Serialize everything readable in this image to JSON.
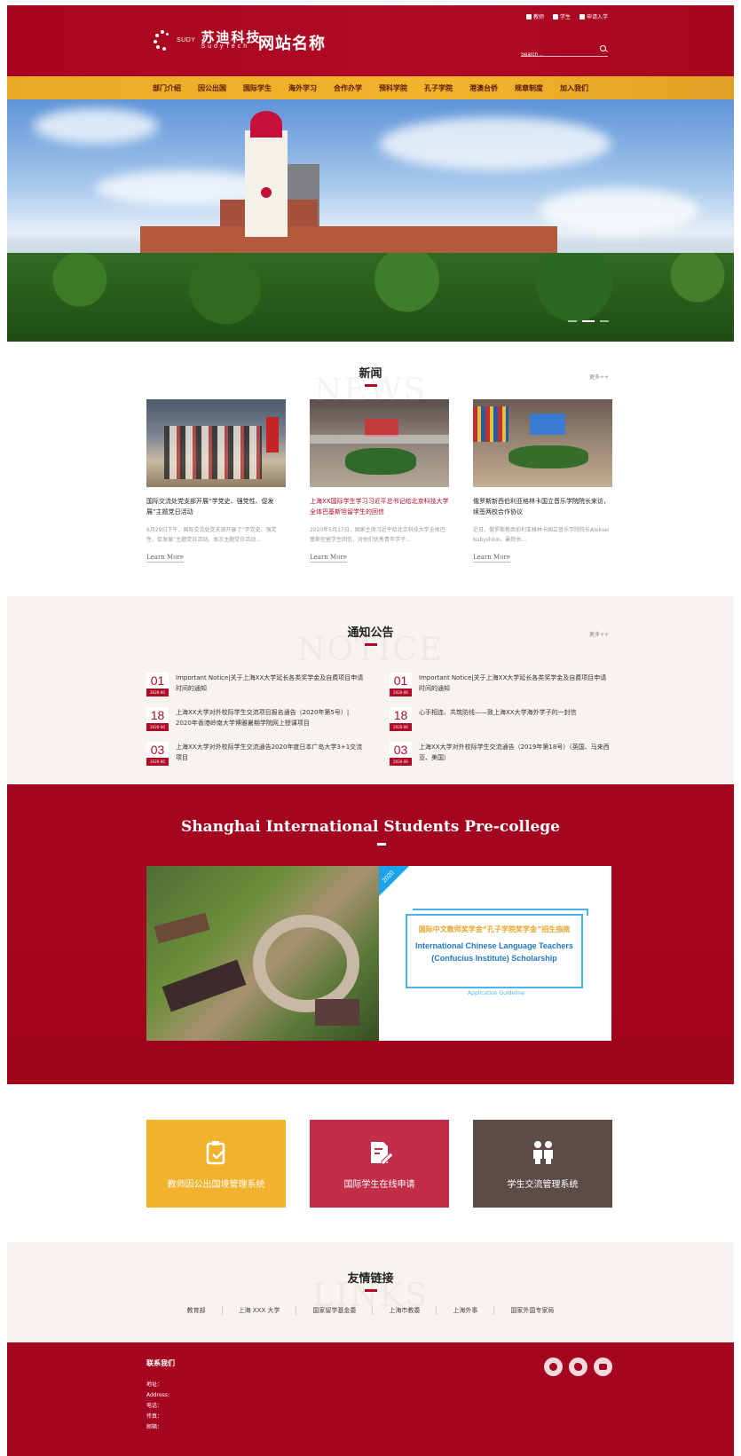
{
  "header": {
    "logo_sudy": "SUDY",
    "logo_cn": "苏迪科技",
    "logo_en": "SudyTech",
    "site_name": "网站名称",
    "top_links": [
      {
        "label": "教师"
      },
      {
        "label": "学生"
      },
      {
        "label": "申请入学"
      }
    ],
    "search_placeholder": "Search ...",
    "colors": {
      "primary": "#a8061f",
      "nav": "#f3b42c"
    }
  },
  "nav": {
    "items": [
      "部门介绍",
      "因公出国",
      "国际学生",
      "海外学习",
      "合作办学",
      "预科学院",
      "孔子学院",
      "港澳台侨",
      "规章制度",
      "加入我们"
    ]
  },
  "news": {
    "title_cn": "新闻",
    "title_en": "NEWS",
    "more": "更多++",
    "cards": [
      {
        "title": "国际交流处党支部开展“学党史、强党性、促发展”主题党日活动",
        "summary": "6月29日下午，国际交流处党支部开展了“学党史、强党性、促发展”主题党日活动。本次主题党日活动...",
        "learn": "Learn More",
        "highlight": false
      },
      {
        "title": "上海XX国际学生学习习近平总书记给北京科技大学全体巴基斯坦留学生的回信",
        "summary": "2020年5月17日，国家主席习近平给北京科技大学全体巴基斯坦留学生回信，对他们优秀青年学子...",
        "learn": "Learn More",
        "highlight": true
      },
      {
        "title": "俄罗斯新西伯利亚格林卡国立音乐学院院长来访，续签两校合作协议",
        "summary": "近日，俄罗斯新西伯利亚格林卡国立音乐学院院长Aleksei Kubyshkin、副院长...",
        "learn": "Learn More",
        "highlight": false
      }
    ]
  },
  "notice": {
    "title_cn": "通知公告",
    "title_en": "NOTICE",
    "more": "更多++",
    "items": [
      {
        "day": "01",
        "ym": "2020-06",
        "text": "Important Notice|关于上海XX大学延长各类奖学金及自费项目申请时间的通知"
      },
      {
        "day": "01",
        "ym": "2020-06",
        "text": "Important Notice|关于上海XX大学延长各类奖学金及自费项目申请时间的通知"
      },
      {
        "day": "18",
        "ym": "2020-06",
        "text": "上海XX大学对外校际学生交流项目报名通告（2020年第5号）| 2020年香港岭南大学博雅暑期学院网上授课项目"
      },
      {
        "day": "18",
        "ym": "2020-06",
        "text": "心手相连、共筑防线——致上海XX大学海外学子的一封信"
      },
      {
        "day": "03",
        "ym": "2020-06",
        "text": "上海XX大学对外校际学生交流通告2020年度日本广岛大学3+1交流项目"
      },
      {
        "day": "03",
        "ym": "2020-06",
        "text": "上海XX大学对外校际学生交流通告（2019年第18号）（英国、马来西亚、美国）"
      }
    ]
  },
  "pre_college": {
    "title": "Shanghai International Students Pre-college",
    "poster": {
      "year": "2020",
      "line1": "国际中文教师奖学金“孔子学院奖学金”招生指南",
      "line2": "International Chinese Language Teachers",
      "line3": "(Confucius Institute) Scholarship",
      "guideline": "Application Guideline"
    }
  },
  "quick_links": [
    {
      "label": "教师因公出国境管理系统",
      "icon": "clipboard-check-icon",
      "color": "#f3b22d"
    },
    {
      "label": "国际学生在线申请",
      "icon": "edit-document-icon",
      "color": "#c22d48"
    },
    {
      "label": "学生交流管理系统",
      "icon": "people-icon",
      "color": "#5d4b48"
    }
  ],
  "friends": {
    "title_cn": "友情链接",
    "title_en": "LINKS",
    "links": [
      "教育部",
      "上海 XXX 大学",
      "国家留学基金委",
      "上海市教委",
      "上海外事",
      "国家外国专家局"
    ]
  },
  "footer": {
    "title": "联系我们",
    "lines": [
      "地址：",
      "Address:",
      "电话：",
      "传真：",
      "邮箱："
    ],
    "social": [
      "wechat-icon",
      "weibo-icon",
      "email-icon"
    ]
  }
}
